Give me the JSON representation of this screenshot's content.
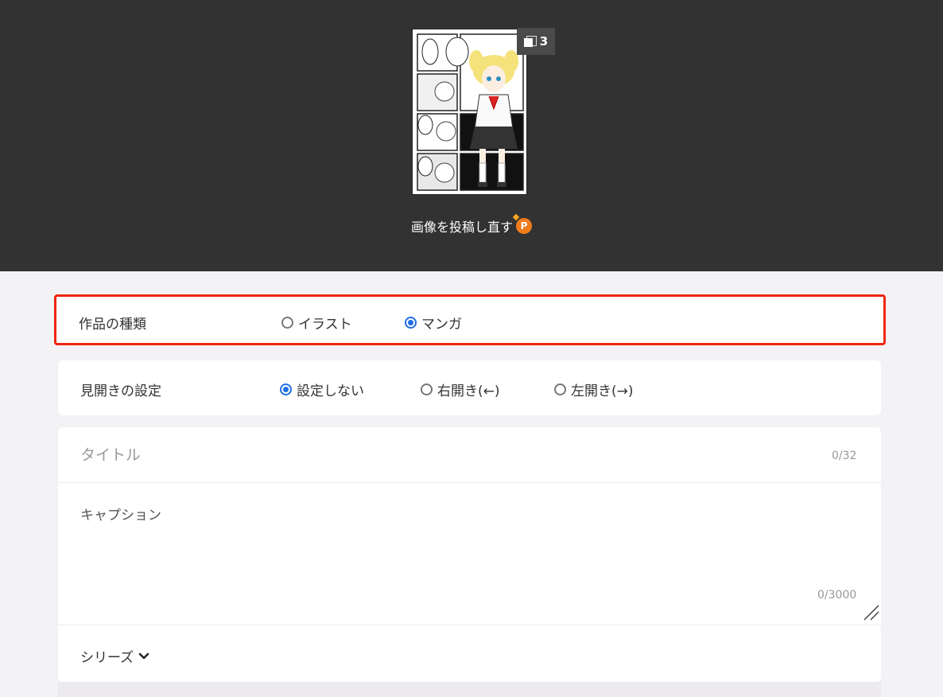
{
  "hero": {
    "page_count": "3",
    "repost_label": "画像を投稿し直す",
    "repost_badge": "P"
  },
  "work_type": {
    "label": "作品の種類",
    "options": [
      "イラスト",
      "マンガ"
    ],
    "selected": "マンガ"
  },
  "spread": {
    "label": "見開きの設定",
    "options": [
      "設定しない",
      "右開き(←)",
      "左開き(→)"
    ],
    "selected": "設定しない"
  },
  "title": {
    "placeholder": "タイトル",
    "value": "",
    "counter": "0/32"
  },
  "caption": {
    "placeholder": "キャプション",
    "value": "",
    "counter": "0/3000"
  },
  "series": {
    "label": "シリーズ"
  },
  "colors": {
    "accent": "#1e6fe8",
    "highlight": "#f0260e",
    "hero_bg": "#323232",
    "badge": "#f07c1c"
  }
}
